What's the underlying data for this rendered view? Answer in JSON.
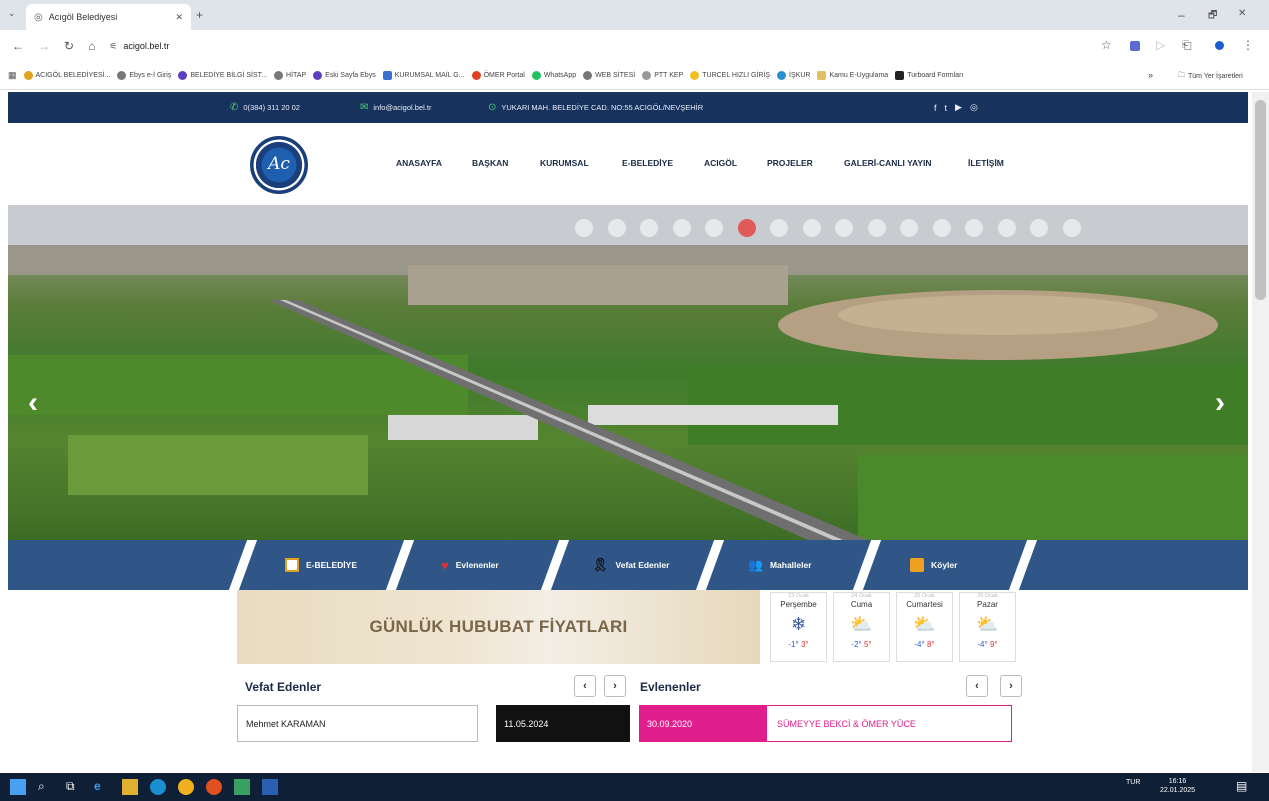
{
  "browser": {
    "tab_title": "Acıgöl Belediyesi",
    "new_tab": "+",
    "address": "acigol.bel.tr",
    "window": {
      "minimize": "–",
      "restore": "🗗",
      "close": "✕"
    },
    "bookmarks": [
      "ACIGÖL BELEDİYESİ...",
      "Ebys e-İ Giriş",
      "BELEDİYE BİLGİ SİST...",
      "HİTAP",
      "Eski Sayfa Ebys",
      "KURUMSAL MAİL G...",
      "ÖMER Portal",
      "WhatsApp",
      "WEB SİTESİ",
      "PTT KEP",
      "TURCEL HIZLI GİRİŞ",
      "İŞKUR",
      "Kamu E-Uygulama",
      "Turboard Formları"
    ],
    "more": "»",
    "other_bookmarks": "Tüm Yer İşaretleri"
  },
  "topbar": {
    "phone": "0(384) 311 20 02",
    "email": "info@acigol.bel.tr",
    "address": "YUKARI MAH. BELEDİYE CAD. NO:55 ACIGÖL/NEVŞEHİR"
  },
  "logo": {
    "text": "Ac"
  },
  "menu": [
    "ANASAYFA",
    "BAŞKAN",
    "KURUMSAL",
    "E-BELEDİYE",
    "ACIGÖL",
    "PROJELER",
    "GALERİ-CANLI YAYIN",
    "İLETİŞİM"
  ],
  "slider": {
    "prev": "‹",
    "next": "›",
    "bullet_count": 16,
    "active_index": 5
  },
  "quick_links": [
    "E-BELEDİYE",
    "Evlenenler",
    "Vefat Edenler",
    "Mahalleler",
    "Köyler"
  ],
  "banner": {
    "text": "GÜNLÜK HUBUBAT FİYATLARI"
  },
  "weather": [
    {
      "date": "23 Ocak",
      "day": "Perşembe",
      "icon": "snow-icon",
      "low": "-1°",
      "high": "3°"
    },
    {
      "date": "24 Ocak",
      "day": "Cuma",
      "icon": "partly-cloudy-icon",
      "low": "-2°",
      "high": "5°"
    },
    {
      "date": "25 Ocak",
      "day": "Cumartesi",
      "icon": "partly-cloudy-icon",
      "low": "-4°",
      "high": "8°"
    },
    {
      "date": "26 Ocak",
      "day": "Pazar",
      "icon": "partly-cloudy-icon",
      "low": "-4°",
      "high": "9°"
    }
  ],
  "vefat": {
    "title": "Vefat Edenler",
    "name": "Mehmet KARAMAN",
    "date": "11.05.2024",
    "prev": "‹",
    "next": "›"
  },
  "evlenenler": {
    "title": "Evlenenler",
    "date": "30.09.2020",
    "names": "SÜMEYYE BEKCİ & ÖMER YÜCE",
    "prev": "‹",
    "next": "›"
  },
  "taskbar": {
    "lang": "TUR",
    "time": "16:16",
    "date": "22.01.2025"
  },
  "colors": {
    "navy": "#17325d",
    "quickbar": "#2f5687",
    "pink": "#e01f8c",
    "active_bullet": "#e05a5a"
  }
}
